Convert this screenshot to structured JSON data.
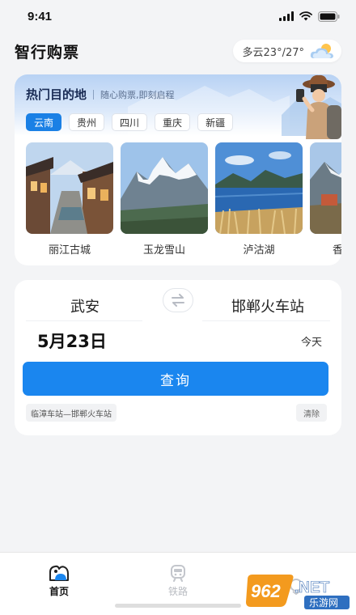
{
  "status_bar": {
    "time": "9:41"
  },
  "header": {
    "title": "智行购票",
    "weather": "多云23°/27°",
    "weather_icon": "partly-cloudy-icon"
  },
  "destinations": {
    "title": "热门目的地",
    "subtitle": "随心购票,即刻启程",
    "chips": [
      "云南",
      "贵州",
      "四川",
      "重庆",
      "新疆"
    ],
    "selected_chip": "云南",
    "places": [
      {
        "name": "丽江古城"
      },
      {
        "name": "玉龙雪山"
      },
      {
        "name": "泸沽湖"
      },
      {
        "name": "香格里拉"
      }
    ]
  },
  "ticket": {
    "from": "武安",
    "to": "邯郸火车站",
    "date": "5月23日",
    "day_label": "今天",
    "search_label": "查询",
    "history": [
      "临漳车站—邯郸火车站"
    ],
    "clear_label": "清除"
  },
  "tab_bar": {
    "tabs": [
      {
        "label": "首页",
        "icon": "home-icon",
        "active": true
      },
      {
        "label": "铁路",
        "icon": "train-icon",
        "active": false
      },
      {
        "label": "",
        "icon": "profile-icon",
        "active": false
      }
    ]
  },
  "watermark": {
    "text_main": "962.NET",
    "text_sub": "乐游网"
  },
  "colors": {
    "accent": "#1a86ef",
    "chip_active": "#1a80e5",
    "background": "#f3f4f6"
  }
}
